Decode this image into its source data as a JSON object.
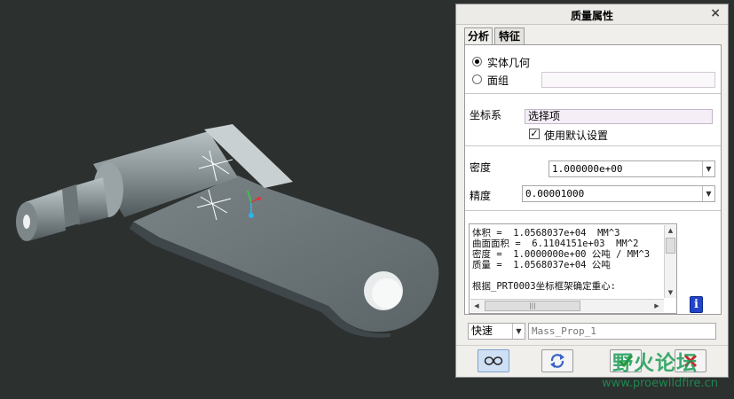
{
  "dialog": {
    "title": "质量属性",
    "close_glyph": "×",
    "tabs": [
      {
        "label": "分析",
        "active": true
      },
      {
        "label": "特征",
        "active": false
      }
    ],
    "geometry": {
      "options": [
        {
          "label": "实体几何",
          "selected": true
        },
        {
          "label": "面组",
          "selected": false
        }
      ],
      "quilt_value": ""
    },
    "coordinate_system": {
      "label": "坐标系",
      "select_text": "选择项",
      "use_default_label": "使用默认设置",
      "use_default_checked": true
    },
    "density": {
      "label": "密度",
      "value": "1.000000e+00"
    },
    "accuracy": {
      "label": "精度",
      "value": "0.00001000"
    },
    "results": {
      "lines": [
        "体积 =  1.0568037e+04  MM^3",
        "曲面面积 =  6.1104151e+03  MM^2",
        "密度 =  1.0000000e+00 公吨 / MM^3",
        "质量 =  1.0568037e+04 公吨",
        "",
        "根据_PRT0003坐标框架确定重心:"
      ],
      "scroll_grip": "|||"
    },
    "mode": {
      "value": "快速"
    },
    "analysis_name": {
      "placeholder": "Mass_Prop_1"
    },
    "buttons": {
      "preview_icon": "glasses-icon",
      "repeat_icon": "repeat-icon",
      "ok_icon": "checkmark-icon",
      "cancel_icon": "x-icon"
    }
  },
  "watermark": {
    "text": "野火论坛",
    "url": "www.proewildfire.cn"
  },
  "colors": {
    "model_body": "#7c8588",
    "background": "#2c302f",
    "axis_x": "#e23434",
    "axis_y": "#32d24a",
    "axis_z": "#29b6e8",
    "watermark": "#1e9c57"
  }
}
